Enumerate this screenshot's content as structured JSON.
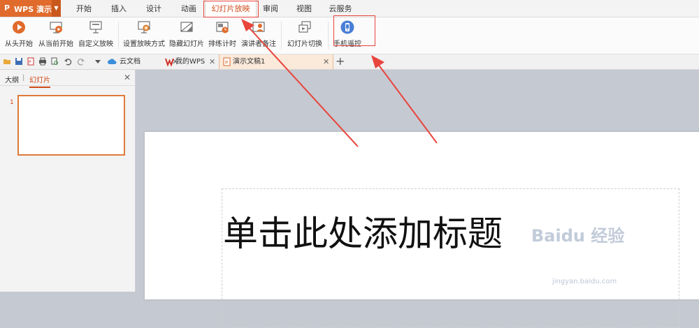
{
  "app": {
    "logo": "P",
    "name": "WPS 演示"
  },
  "menu": {
    "tabs": [
      {
        "label": "开始"
      },
      {
        "label": "插入"
      },
      {
        "label": "设计"
      },
      {
        "label": "动画"
      },
      {
        "label": "幻灯片放映"
      },
      {
        "label": "审阅"
      },
      {
        "label": "视图"
      },
      {
        "label": "云服务"
      }
    ],
    "active_tab": "幻灯片放映"
  },
  "ribbon": {
    "items": [
      {
        "label": "从头开始",
        "icon": "play-icon"
      },
      {
        "label": "从当前开始",
        "icon": "play-current-icon"
      },
      {
        "label": "自定义放映",
        "icon": "custom-show-icon"
      },
      {
        "label": "设置放映方式",
        "icon": "setup-show-icon"
      },
      {
        "label": "隐藏幻灯片",
        "icon": "hide-slide-icon"
      },
      {
        "label": "排练计时",
        "icon": "rehearse-timing-icon"
      },
      {
        "label": "演讲者备注",
        "icon": "speaker-notes-icon"
      },
      {
        "label": "幻灯片切换",
        "icon": "slide-transition-icon"
      },
      {
        "label": "手机遥控",
        "icon": "phone-remote-icon"
      }
    ]
  },
  "doc_tabs": [
    {
      "label": "云文档",
      "icon": "cloud-doc-icon"
    },
    {
      "label": "我的WPS",
      "icon": "wps-logo-icon"
    },
    {
      "label": "演示文稿1",
      "icon": "presentation-file-icon"
    }
  ],
  "left_panel": {
    "tabs": [
      {
        "label": "大纲"
      },
      {
        "label": "幻灯片"
      }
    ],
    "divider": "|",
    "active_tab": "幻灯片",
    "slide_number": "1"
  },
  "slide": {
    "title": "单击此处添加标题"
  },
  "watermark": {
    "text": "Baidu 经验",
    "url": "jingyan.baidu.com"
  },
  "colors": {
    "brand": "#e06b2c",
    "accent": "#d04a1a",
    "arrow": "#e8453c",
    "remote_icon": "#4a7fd6"
  }
}
